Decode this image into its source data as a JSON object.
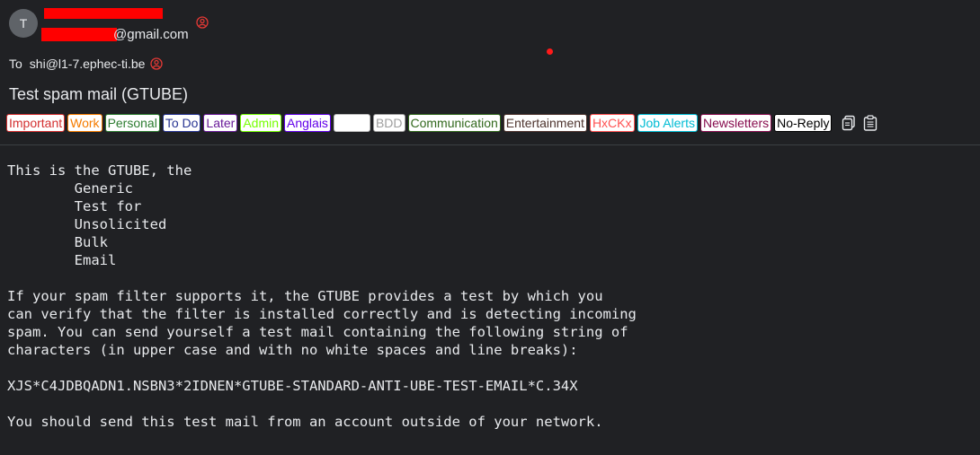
{
  "sender": {
    "avatar_letter": "T",
    "email_visible_suffix": "@gmail.com"
  },
  "recipient": {
    "to_label": "To",
    "address": "shi@l1-7.ephec-ti.be"
  },
  "subject": "Test spam mail (GTUBE)",
  "tags": [
    {
      "label": "Important",
      "color": "#d32f2f"
    },
    {
      "label": "Work",
      "color": "#f57c00"
    },
    {
      "label": "Personal",
      "color": "#2e7d32"
    },
    {
      "label": "To Do",
      "color": "#283593"
    },
    {
      "label": "Later",
      "color": "#6a1b9a"
    },
    {
      "label": "Admin",
      "color": "#76ff03"
    },
    {
      "label": "Anglais",
      "color": "#6200ea"
    },
    {
      "label": "",
      "color": "#ffffff"
    },
    {
      "label": "BDD",
      "color": "#9e9e9e"
    },
    {
      "label": "Communication",
      "color": "#33691e"
    },
    {
      "label": "Entertainment",
      "color": "#4e342e"
    },
    {
      "label": "HxCKx",
      "color": "#ff5252"
    },
    {
      "label": "Job Alerts",
      "color": "#00bcd4"
    },
    {
      "label": "Newsletters",
      "color": "#880e4f"
    },
    {
      "label": "No-Reply",
      "color": "#000000"
    }
  ],
  "toolbar": {
    "copy_icon": "copy-icon",
    "clipboard_icon": "clipboard-icon"
  },
  "body_lines": [
    "This is the GTUBE, the",
    "        Generic",
    "        Test for",
    "        Unsolicited",
    "        Bulk",
    "        Email",
    "",
    "If your spam filter supports it, the GTUBE provides a test by which you",
    "can verify that the filter is installed correctly and is detecting incoming",
    "spam. You can send yourself a test mail containing the following string of",
    "characters (in upper case and with no white spaces and line breaks):",
    "",
    "XJS*C4JDBQADN1.NSBN3*2IDNEN*GTUBE-STANDARD-ANTI-UBE-TEST-EMAIL*C.34X",
    "",
    "You should send this test mail from an account outside of your network."
  ]
}
